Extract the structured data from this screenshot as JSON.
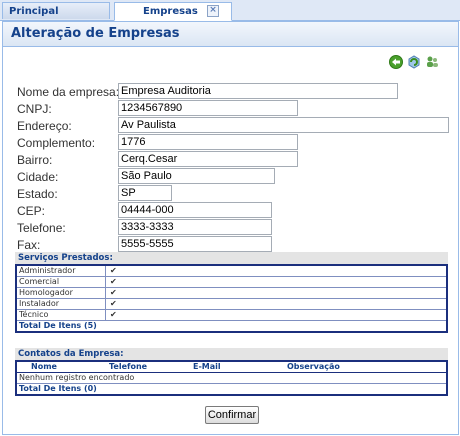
{
  "tabs": [
    {
      "label": "Principal"
    },
    {
      "label": "Empresas",
      "close_icon": "×"
    }
  ],
  "page": {
    "title": "Alteração de Empresas"
  },
  "toolbar_icons": [
    "back-arrow-icon",
    "refresh-icon",
    "users-icon"
  ],
  "form": {
    "nome_label": "Nome da empresa:",
    "nome_value": "Empresa Auditoria",
    "cnpj_label": "CNPJ:",
    "cnpj_value": "1234567890",
    "endereco_label": "Endereço:",
    "endereco_value": "Av Paulista",
    "complemento_label": "Complemento:",
    "complemento_value": "1776",
    "bairro_label": "Bairro:",
    "bairro_value": "Cerq.Cesar",
    "cidade_label": "Cidade:",
    "cidade_value": "São Paulo",
    "estado_label": "Estado:",
    "estado_value": "SP",
    "cep_label": "CEP:",
    "cep_value": "04444-000",
    "telefone_label": "Telefone:",
    "telefone_value": "3333-3333",
    "fax_label": "Fax:",
    "fax_value": "5555-5555"
  },
  "servicos": {
    "title": "Serviços Prestados:",
    "rows": [
      {
        "name": "Administrador",
        "check": "✔"
      },
      {
        "name": "Comercial",
        "check": "✔"
      },
      {
        "name": "Homologador",
        "check": "✔"
      },
      {
        "name": "Instalador",
        "check": "✔"
      },
      {
        "name": "Técnico",
        "check": "✔"
      }
    ],
    "total": "Total De Itens (5)"
  },
  "contatos": {
    "title": "Contatos da Empresa:",
    "headers": [
      "Nome",
      "Telefone",
      "E-Mail",
      "Observação"
    ],
    "empty": "Nenhum registro encontrado",
    "total": "Total De Itens (0)"
  },
  "confirm_label": "Confirmar",
  "colors": {
    "accent": "#15428b",
    "border": "#99bbe8",
    "table_border": "#1b2f7d"
  }
}
